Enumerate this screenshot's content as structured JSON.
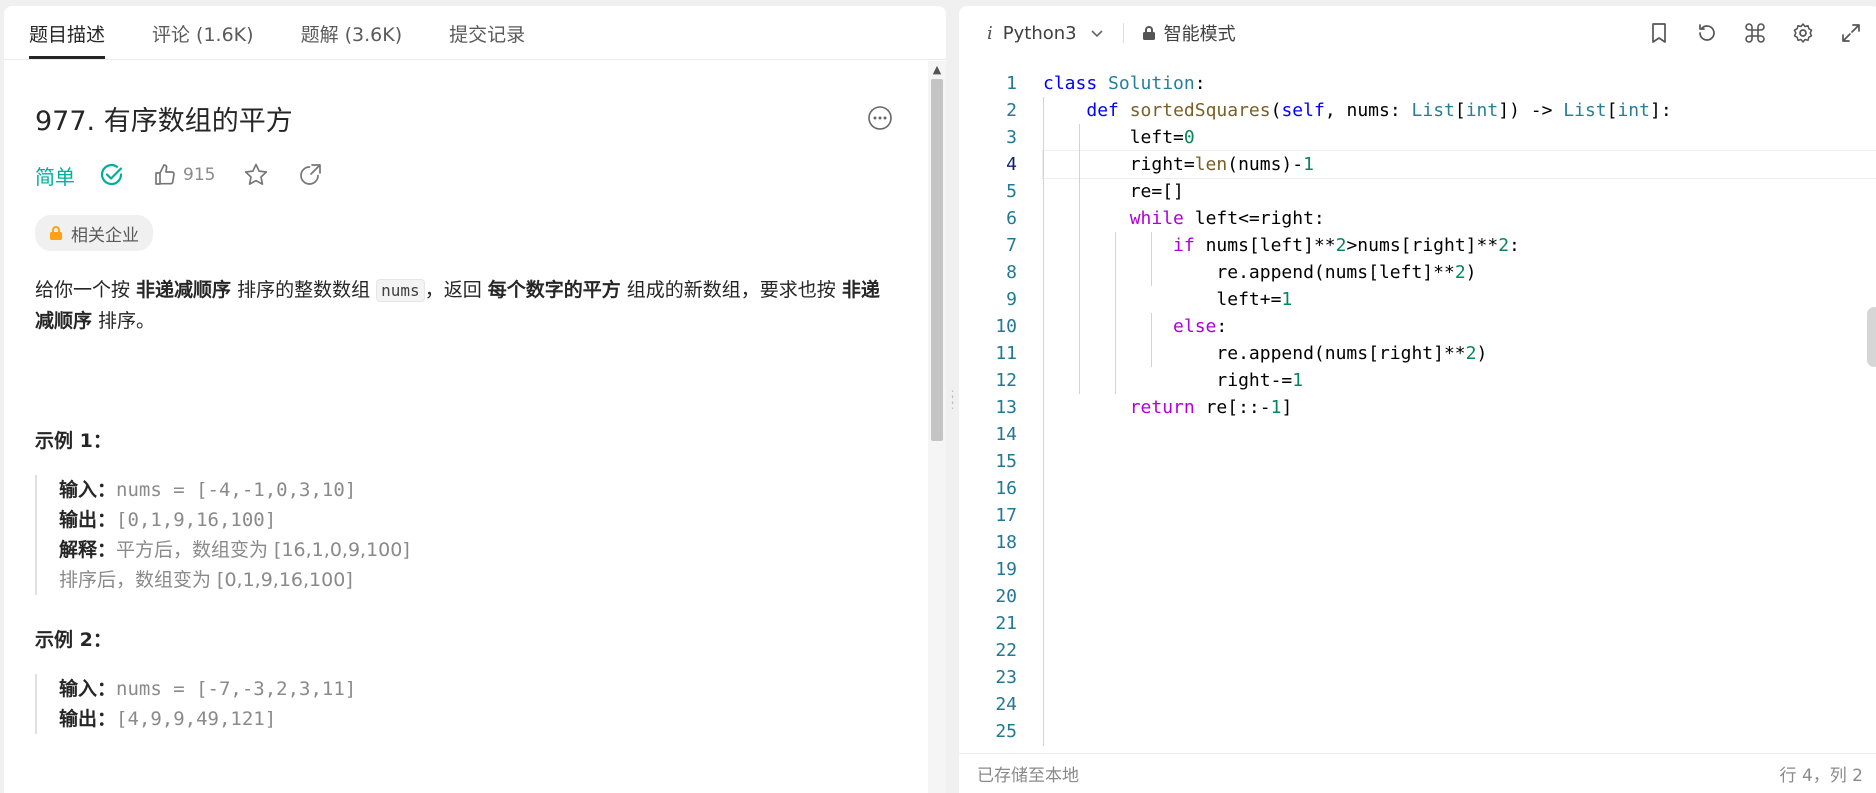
{
  "tabs": [
    "题目描述",
    "评论 (1.6K)",
    "题解 (3.6K)",
    "提交记录"
  ],
  "problem": {
    "title": "977. 有序数组的平方",
    "difficulty": "简单",
    "likes": "915",
    "company_tag": "相关企业",
    "desc_p1": "给你一个按 ",
    "desc_b1": "非递减顺序",
    "desc_p2": " 排序的整数数组 ",
    "desc_code": "nums",
    "desc_p3": "，返回 ",
    "desc_b2": "每个数字的平方",
    "desc_p4": " 组成的新数组，要求也按 ",
    "desc_b3": "非递减顺序",
    "desc_p5": " 排序。"
  },
  "examples": [
    {
      "title": "示例 1：",
      "input_label": "输入：",
      "input": "nums = [-4,-1,0,3,10]",
      "output_label": "输出：",
      "output": "[0,1,9,16,100]",
      "explain_label": "解释：",
      "explain1": "平方后，数组变为 [16,1,0,9,100]",
      "explain2": "排序后，数组变为 [0,1,9,16,100]"
    },
    {
      "title": "示例 2：",
      "input_label": "输入：",
      "input": "nums = [-7,-3,2,3,11]",
      "output_label": "输出：",
      "output": "[4,9,9,49,121]"
    }
  ],
  "editor": {
    "language": "Python3",
    "mode": "智能模式",
    "status_left": "已存储至本地",
    "status_right": "行 4，列 2",
    "line_numbers": [
      "1",
      "2",
      "3",
      "4",
      "5",
      "6",
      "7",
      "8",
      "9",
      "10",
      "11",
      "12",
      "13",
      "14",
      "15",
      "16",
      "17",
      "18",
      "19",
      "20",
      "21",
      "22",
      "23",
      "24",
      "25"
    ],
    "current_line": 4
  }
}
